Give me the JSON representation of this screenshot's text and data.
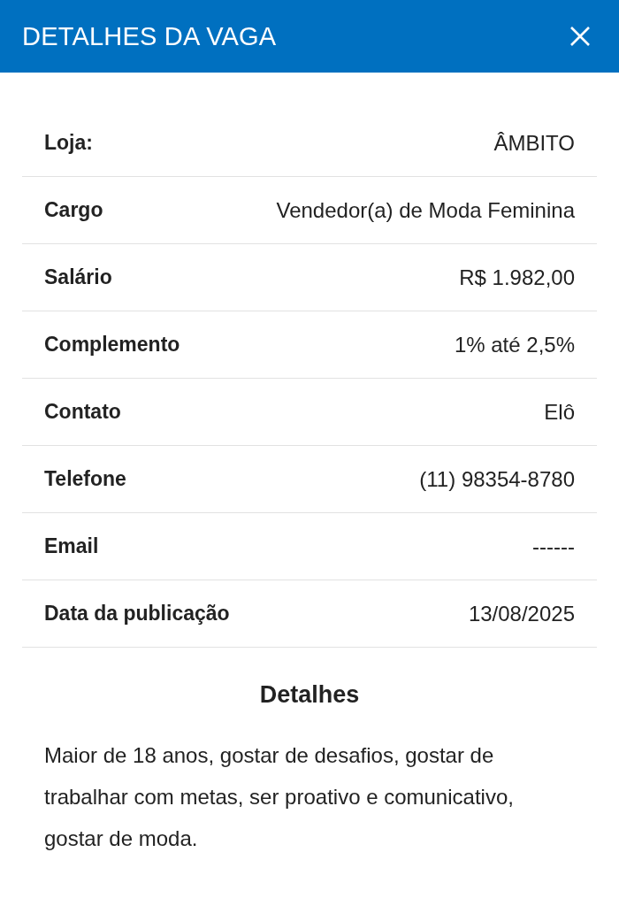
{
  "header": {
    "title": "DETALHES DA VAGA"
  },
  "details": [
    {
      "label": "Loja:",
      "value": "ÂMBITO"
    },
    {
      "label": "Cargo",
      "value": "Vendedor(a) de Moda Feminina"
    },
    {
      "label": "Salário",
      "value": "R$ 1.982,00"
    },
    {
      "label": "Complemento",
      "value": "1% até 2,5%"
    },
    {
      "label": "Contato",
      "value": "Elô"
    },
    {
      "label": "Telefone",
      "value": "(11) 98354-8780"
    },
    {
      "label": "Email",
      "value": "------"
    },
    {
      "label": "Data da publicação",
      "value": "13/08/2025"
    }
  ],
  "description": {
    "heading": "Detalhes",
    "text": "Maior de 18 anos, gostar de desafios, gostar de trabalhar com metas, ser proativo e comunicativo, gostar de moda."
  }
}
